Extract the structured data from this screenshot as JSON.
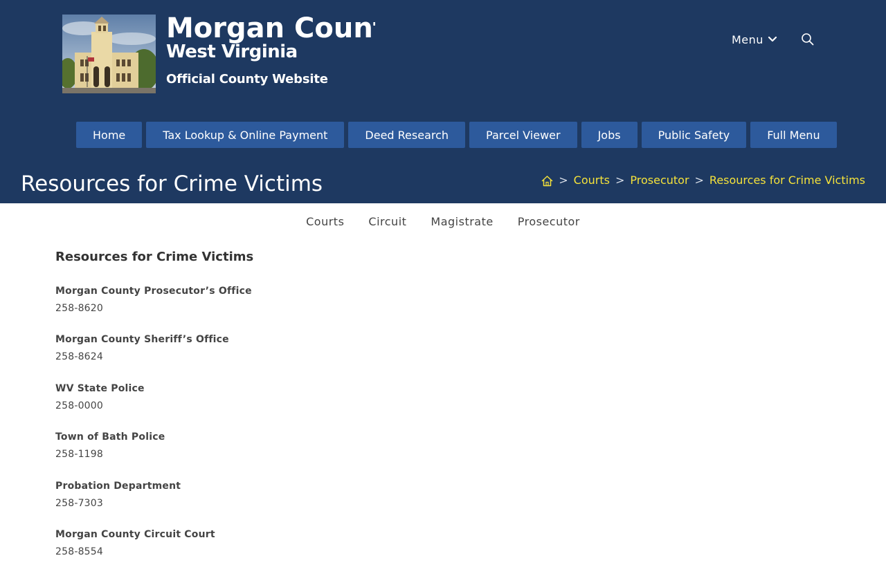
{
  "site": {
    "title": "Morgan County",
    "subtitle": "West Virginia",
    "tagline": "Official County Website"
  },
  "header": {
    "menu_label": "Menu",
    "menu_icon": "chevron-down-icon",
    "search_icon": "search-icon"
  },
  "nav": [
    {
      "label": "Home"
    },
    {
      "label": "Tax Lookup & Online Payment"
    },
    {
      "label": "Deed Research"
    },
    {
      "label": "Parcel Viewer"
    },
    {
      "label": "Jobs"
    },
    {
      "label": "Public Safety"
    },
    {
      "label": "Full Menu"
    }
  ],
  "page": {
    "title": "Resources for Crime Victims"
  },
  "breadcrumb": {
    "home_icon": "home-icon",
    "separator": ">",
    "items": [
      {
        "label": "Courts"
      },
      {
        "label": "Prosecutor"
      },
      {
        "label": "Resources for Crime Victims"
      }
    ]
  },
  "subnav": [
    {
      "label": "Courts"
    },
    {
      "label": "Circuit"
    },
    {
      "label": "Magistrate"
    },
    {
      "label": "Prosecutor"
    }
  ],
  "content": {
    "heading": "Resources for Crime Victims",
    "contacts": [
      {
        "name": "Morgan County Prosecutor’s Office",
        "phone": "258-8620"
      },
      {
        "name": "Morgan County Sheriff’s Office",
        "phone": "258-8624"
      },
      {
        "name": "WV State Police",
        "phone": "258-0000"
      },
      {
        "name": "Town of Bath Police",
        "phone": "258-1198"
      },
      {
        "name": "Probation Department",
        "phone": "258-7303"
      },
      {
        "name": "Morgan County Circuit Court",
        "phone": "258-8554"
      }
    ]
  },
  "colors": {
    "header_bg": "#1e3961",
    "nav_button_bg": "#2d5a9c",
    "breadcrumb_link": "#f5e23a",
    "text": "#333333"
  }
}
